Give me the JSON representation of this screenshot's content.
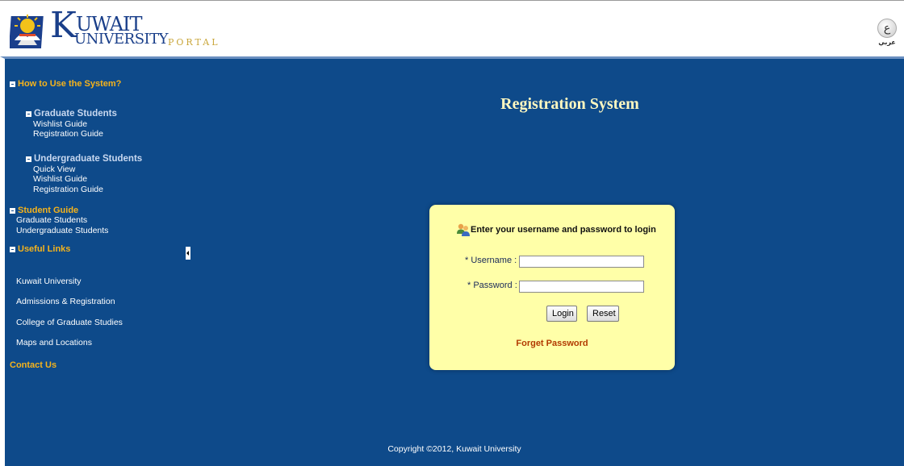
{
  "header": {
    "logo_k": "K",
    "logo_uwait": "UWAIT",
    "logo_university": "UNIVERSITY",
    "logo_portal": "PORTAL",
    "language_glyph": "ع",
    "language_label": "عربي"
  },
  "sidebar": {
    "how_to_use": "How to Use the System?",
    "graduate_students": "Graduate Students",
    "graduate_links": [
      "Wishlist Guide",
      "Registration Guide"
    ],
    "undergraduate_students": "Undergraduate Students",
    "undergraduate_links": [
      "Quick View",
      "Wishlist Guide",
      "Registration Guide"
    ],
    "student_guide": "Student Guide",
    "student_guide_links": [
      "Graduate Students",
      "Undergraduate Students"
    ],
    "useful_links": "Useful Links",
    "useful_link_items": [
      "Kuwait University",
      "Admissions & Registration",
      "College of Graduate Studies",
      "Maps and Locations"
    ],
    "contact_us": "Contact Us"
  },
  "main": {
    "title": "Registration System",
    "login": {
      "heading": "Enter your username and password to login",
      "username_label": "* Username :",
      "password_label": "* Password :",
      "username_value": "",
      "password_value": "",
      "login_button": "Login",
      "reset_button": "Reset",
      "forget_password": "Forget Password"
    },
    "copyright": "Copyright ©2012, Kuwait University"
  },
  "colors": {
    "background_blue": "#0e4a8a",
    "category_gold": "#f5b31c",
    "login_box_yellow": "#ffffa8",
    "forget_link": "#b23a00"
  }
}
